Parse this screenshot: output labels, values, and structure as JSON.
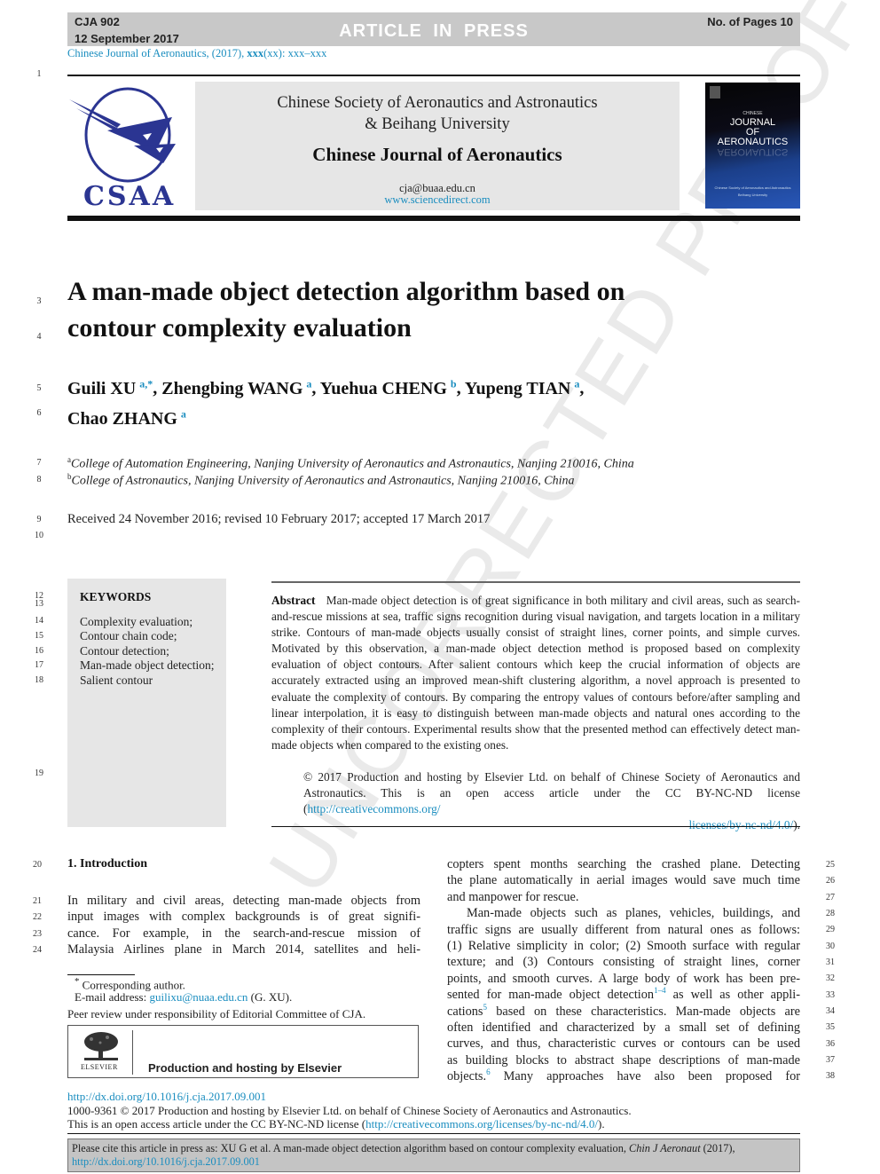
{
  "banner": {
    "code": "CJA 902",
    "date": "12 September 2017",
    "status": "ARTICLE IN PRESS",
    "pages": "No. of Pages 10"
  },
  "journal_ref": {
    "prefix": "Chinese Journal of Aeronautics, (2017), ",
    "volume": "xxx",
    "suffix": "(xx): xxx–xxx"
  },
  "masthead": {
    "logo_text": "CSAA",
    "society_line1": "Chinese Society of Aeronautics and Astronautics",
    "society_line2": "& Beihang University",
    "journal_name": "Chinese Journal of Aeronautics",
    "email": "cja@buaa.edu.cn",
    "url": "www.sciencedirect.com",
    "cover": {
      "small": "CHINESE",
      "line1": "JOURNAL",
      "line2": "OF",
      "line3": "AERONAUTICS",
      "foot1": "Chinese Society of Aeronautics and Astronautics",
      "foot2": "Beihang University"
    }
  },
  "line_numbers": {
    "l1": "1",
    "l3": "3",
    "l4": "4",
    "l5": "5",
    "l6": "6",
    "l7": "7",
    "l8": "8",
    "l9": "9",
    "l10": "10",
    "l12": "12",
    "l13": "13",
    "l14": "14",
    "l15": "15",
    "l16": "16",
    "l17": "17",
    "l18": "18",
    "l19": "19",
    "l20": "20",
    "l21": "21",
    "l22": "22",
    "l23": "23",
    "l24": "24",
    "l25": "25",
    "l26": "26",
    "l27": "27",
    "l28": "28",
    "l29": "29",
    "l30": "30",
    "l31": "31",
    "l32": "32",
    "l33": "33",
    "l34": "34",
    "l35": "35",
    "l36": "36",
    "l37": "37",
    "l38": "38"
  },
  "article": {
    "title_line1": "A man-made object detection algorithm based on",
    "title_line2": "contour complexity evaluation",
    "authors": [
      {
        "name": "Guili XU",
        "sup": "a,*"
      },
      {
        "name": "Zhengbing WANG",
        "sup": "a"
      },
      {
        "name": "Yuehua CHENG",
        "sup": "b"
      },
      {
        "name": "Yupeng TIAN",
        "sup": "a"
      },
      {
        "name": "Chao ZHANG",
        "sup": "a"
      }
    ],
    "affiliations": [
      {
        "sup": "a",
        "text": "College of Automation Engineering, Nanjing University of Aeronautics and Astronautics, Nanjing 210016, China"
      },
      {
        "sup": "b",
        "text": "College of Astronautics, Nanjing University of Aeronautics and Astronautics, Nanjing 210016, China"
      }
    ],
    "received": "Received 24 November 2016; revised 10 February 2017; accepted 17 March 2017"
  },
  "keywords": {
    "heading": "KEYWORDS",
    "items": [
      "Complexity evaluation;",
      "Contour chain code;",
      "Contour detection;",
      "Man-made object detection;",
      "Salient contour"
    ]
  },
  "abstract": {
    "label": "Abstract",
    "text": "Man-made object detection is of great significance in both military and civil areas, such as search-and-rescue missions at sea, traffic signs recognition during visual navigation, and targets location in a military strike. Contours of man-made objects usually consist of straight lines, corner points, and simple curves. Motivated by this observation, a man-made object detection method is proposed based on complexity evaluation of object contours. After salient contours which keep the crucial information of objects are accurately extracted using an improved mean-shift clustering algorithm, a novel approach is presented to evaluate the complexity of contours. By comparing the entropy values of contours before/after sampling and linear interpolation, it is easy to distinguish between man-made objects and natural ones according to the complexity of their contours. Experimental results show that the presented method can effectively detect man-made objects when compared to the existing ones.",
    "copyright_text": "© 2017 Production and hosting by Elsevier Ltd. on behalf of Chinese Society of Aeronautics and Astronautics. This is an open access article under the CC BY-NC-ND license (",
    "copyright_link1": "http://creativecommons.org/",
    "copyright_link2": "licenses/by-nc-nd/4.0/",
    "copyright_end": ")."
  },
  "introduction": {
    "heading": "1. Introduction",
    "left_lines": [
      "In military and civil areas, detecting man-made objects from",
      "input images with complex backgrounds is of great signifi-",
      "cance. For example, in the search-and-rescue mission of",
      "Malaysia Airlines plane in March 2014, satellites and heli-"
    ],
    "right_lines": [
      "copters spent months searching the crashed plane. Detecting",
      "the plane automatically in aerial images would save much time",
      "and manpower for rescue.",
      "Man-made objects such as planes, vehicles, buildings, and",
      "traffic signs are usually different from natural ones as follows:",
      "(1) Relative simplicity in color; (2) Smooth surface with regular",
      "texture; and (3) Contours consisting of straight lines, corner",
      "points, and smooth curves. A large body of work has been pre-",
      "sented for man-made object detection",
      "cations",
      "often identified and characterized by a small set of defining",
      "curves, and thus, characteristic curves or contours can be used",
      "as building blocks to abstract shape descriptions of man-made",
      "objects."
    ],
    "right_line9_ref": "1–4",
    "right_line9_tail": " as well as other appli-",
    "right_line10_ref": "5",
    "right_line10_tail": " based on these characteristics. Man-made objects are",
    "right_line14_ref": "6",
    "right_line14_tail": " Many approaches have also been proposed for"
  },
  "footnotes": {
    "corresponding": "Corresponding author.",
    "corresponding_mark": "*",
    "email_label": "E-mail address: ",
    "email": "guilixu@nuaa.edu.cn",
    "email_tail": " (G. XU).",
    "peer_review": "Peer review under responsibility of Editorial Committee of CJA.",
    "elsevier_label": "ELSEVIER",
    "production": "Production and hosting by Elsevier"
  },
  "doi_block": {
    "doi": "http://dx.doi.org/10.1016/j.cja.2017.09.001",
    "issn_line": "1000-9361 © 2017 Production and hosting by Elsevier Ltd. on behalf of Chinese Society of Aeronautics and Astronautics.",
    "license_prefix": "This is an open access article under the CC BY-NC-ND license (",
    "license_link": "http://creativecommons.org/licenses/by-nc-nd/4.0/",
    "license_end": ")."
  },
  "citation": {
    "prefix": "Please cite this article in press as: XU G et al. A man-made object detection algorithm based on contour complexity evaluation, ",
    "journal_abbrev": "Chin J Aeronaut",
    "year": " (2017), ",
    "link": "http://dx.doi.org/10.1016/j.cja.2017.09.001"
  },
  "watermark": "UNCORRECTED PROOF",
  "colors": {
    "link": "#1a8dbf",
    "csaa_blue": "#2b3592",
    "banner_gray": "#c8c8c8",
    "box_gray": "#e6e6e6"
  }
}
